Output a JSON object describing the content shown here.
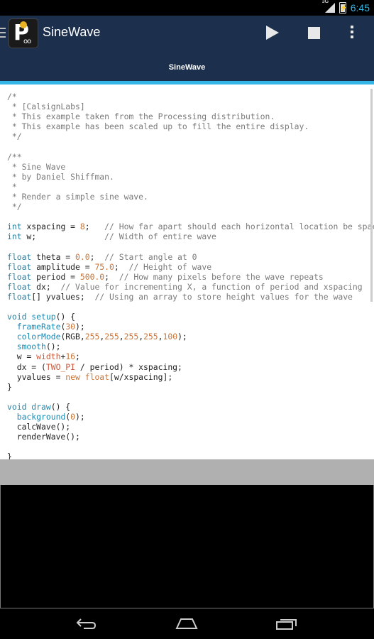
{
  "statusbar": {
    "network": "3G",
    "time": "6:45"
  },
  "app": {
    "title": "SineWave"
  },
  "tab": {
    "label": "SineWave"
  },
  "colors": {
    "actionbar": "#1c2f4d",
    "accent": "#33b5e5",
    "keyword": "#2e7e9e",
    "comment": "#7a7a7a",
    "number": "#c8753a"
  },
  "icons": [
    "menu-icon",
    "app-logo-icon",
    "play-icon",
    "stop-icon",
    "overflow-menu-icon",
    "back-icon",
    "home-icon",
    "recent-apps-icon"
  ],
  "code": [
    [
      [
        "c",
        "/*"
      ]
    ],
    [
      [
        "c",
        " * [CalsignLabs]"
      ]
    ],
    [
      [
        "c",
        " * This example taken from the Processing distribution."
      ]
    ],
    [
      [
        "c",
        " * This example has been scaled up to fill the entire display."
      ]
    ],
    [
      [
        "c",
        " */"
      ]
    ],
    [
      [
        "",
        ""
      ]
    ],
    [
      [
        "c",
        "/**"
      ]
    ],
    [
      [
        "c",
        " * Sine Wave"
      ]
    ],
    [
      [
        "c",
        " * by Daniel Shiffman."
      ]
    ],
    [
      [
        "c",
        " *"
      ]
    ],
    [
      [
        "c",
        " * Render a simple sine wave."
      ]
    ],
    [
      [
        "c",
        " */"
      ]
    ],
    [
      [
        "",
        ""
      ]
    ],
    [
      [
        "k",
        "int"
      ],
      [
        "",
        " xspacing = "
      ],
      [
        "n",
        "8"
      ],
      [
        "",
        ";   "
      ],
      [
        "c",
        "// How far apart should each horizontal location be spaced"
      ]
    ],
    [
      [
        "k",
        "int"
      ],
      [
        "",
        " w;              "
      ],
      [
        "c",
        "// Width of entire wave"
      ]
    ],
    [
      [
        "",
        ""
      ]
    ],
    [
      [
        "k",
        "float"
      ],
      [
        "",
        " theta = "
      ],
      [
        "n",
        "0.0"
      ],
      [
        "",
        ";  "
      ],
      [
        "c",
        "// Start angle at 0"
      ]
    ],
    [
      [
        "k",
        "float"
      ],
      [
        "",
        " amplitude = "
      ],
      [
        "n",
        "75.0"
      ],
      [
        "",
        ";  "
      ],
      [
        "c",
        "// Height of wave"
      ]
    ],
    [
      [
        "k",
        "float"
      ],
      [
        "",
        " period = "
      ],
      [
        "n",
        "500.0"
      ],
      [
        "",
        ";  "
      ],
      [
        "c",
        "// How many pixels before the wave repeats"
      ]
    ],
    [
      [
        "k",
        "float"
      ],
      [
        "",
        " dx;  "
      ],
      [
        "c",
        "// Value for incrementing X, a function of period and xspacing"
      ]
    ],
    [
      [
        "k",
        "float"
      ],
      [
        "",
        "[] yvalues;  "
      ],
      [
        "c",
        "// Using an array to store height values for the wave"
      ]
    ],
    [
      [
        "",
        ""
      ]
    ],
    [
      [
        "k",
        "void"
      ],
      [
        "",
        " "
      ],
      [
        "f",
        "setup"
      ],
      [
        "",
        "() {"
      ]
    ],
    [
      [
        "",
        "  "
      ],
      [
        "f",
        "frameRate"
      ],
      [
        "",
        "("
      ],
      [
        "n",
        "30"
      ],
      [
        "",
        ");"
      ]
    ],
    [
      [
        "",
        "  "
      ],
      [
        "f",
        "colorMode"
      ],
      [
        "",
        "(RGB,"
      ],
      [
        "n",
        "255"
      ],
      [
        "",
        ","
      ],
      [
        "n",
        "255"
      ],
      [
        "",
        ","
      ],
      [
        "n",
        "255"
      ],
      [
        "",
        ","
      ],
      [
        "n",
        "255"
      ],
      [
        "",
        ","
      ],
      [
        "n",
        "100"
      ],
      [
        "",
        ");"
      ]
    ],
    [
      [
        "",
        "  "
      ],
      [
        "f",
        "smooth"
      ],
      [
        "",
        "();"
      ]
    ],
    [
      [
        "",
        "  w = "
      ],
      [
        "o",
        "width"
      ],
      [
        "",
        "+"
      ],
      [
        "n",
        "16"
      ],
      [
        "",
        ";"
      ]
    ],
    [
      [
        "",
        "  dx = ("
      ],
      [
        "o",
        "TWO_PI"
      ],
      [
        "",
        " / period) * xspacing;"
      ]
    ],
    [
      [
        "",
        "  yvalues = "
      ],
      [
        "n",
        "new"
      ],
      [
        "",
        " "
      ],
      [
        "n",
        "float"
      ],
      [
        "",
        "[w/xspacing];"
      ]
    ],
    [
      [
        "",
        "}"
      ]
    ],
    [
      [
        "",
        ""
      ]
    ],
    [
      [
        "k",
        "void"
      ],
      [
        "",
        " "
      ],
      [
        "f",
        "draw"
      ],
      [
        "",
        "() {"
      ]
    ],
    [
      [
        "",
        "  "
      ],
      [
        "f",
        "background"
      ],
      [
        "",
        "("
      ],
      [
        "n",
        "0"
      ],
      [
        "",
        ");"
      ]
    ],
    [
      [
        "",
        "  calcWave();"
      ]
    ],
    [
      [
        "",
        "  renderWave();"
      ]
    ],
    [
      [
        "",
        ""
      ]
    ],
    [
      [
        "",
        "}"
      ]
    ]
  ]
}
